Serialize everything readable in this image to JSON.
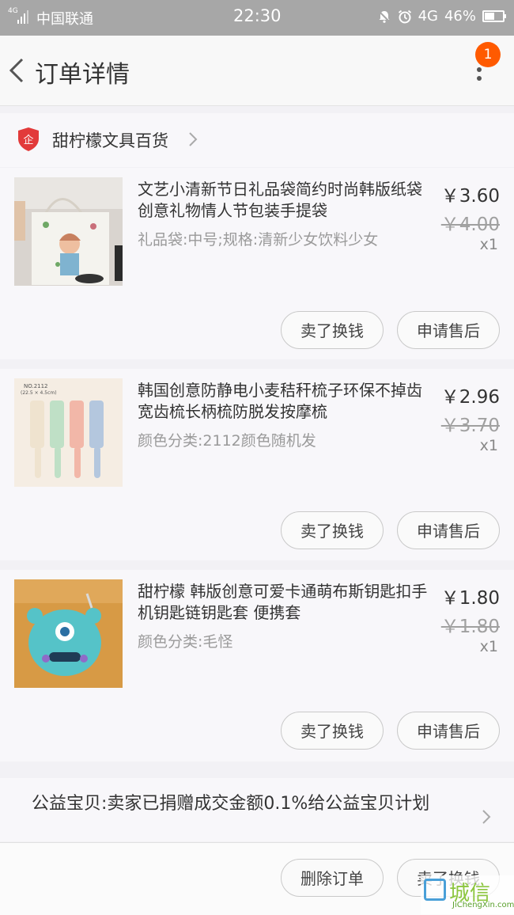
{
  "status_bar": {
    "network_small": "4G",
    "carrier": "中国联通",
    "time": "22:30",
    "network": "4G",
    "battery": "46%"
  },
  "navbar": {
    "title": "订单详情",
    "badge_count": "1"
  },
  "shop": {
    "name": "甜柠檬文具百货"
  },
  "items": [
    {
      "title": "文艺小清新节日礼品袋简约时尚韩版纸袋创意礼物情人节包装手提袋",
      "spec": "礼品袋:中号;规格:清新少女饮料少女",
      "price": "￥3.60",
      "original_price": "￥4.00",
      "quantity": "x1",
      "btn_sell": "卖了换钱",
      "btn_after_sale": "申请售后"
    },
    {
      "title": "韩国创意防静电小麦秸秆梳子环保不掉齿宽齿梳长柄梳防脱发按摩梳",
      "spec": "颜色分类:2112颜色随机发",
      "price": "￥2.96",
      "original_price": "￥3.70",
      "quantity": "x1",
      "btn_sell": "卖了换钱",
      "btn_after_sale": "申请售后",
      "thumb_text": "NO.2112",
      "thumb_subtext": "(22.5 × 4.5cm)"
    },
    {
      "title": "甜柠檬 韩版创意可爱卡通萌布斯钥匙扣手机钥匙链钥匙套 便携套",
      "spec": "颜色分类:毛怪",
      "price": "￥1.80",
      "original_price": "￥1.80",
      "quantity": "x1",
      "btn_sell": "卖了换钱",
      "btn_after_sale": "申请售后"
    }
  ],
  "charity": {
    "text": "公益宝贝:卖家已捐赠成交金额0.1%给公益宝贝计划"
  },
  "bottom_bar": {
    "delete_label": "删除订单",
    "sell_label": "卖了换钱"
  },
  "watermark": {
    "cn": "城信",
    "en": "JiChengXin.com"
  },
  "colors": {
    "badge": "#ff5a00",
    "status_bar": "#a7a7a7",
    "shop_logo": "#e23a3a"
  }
}
